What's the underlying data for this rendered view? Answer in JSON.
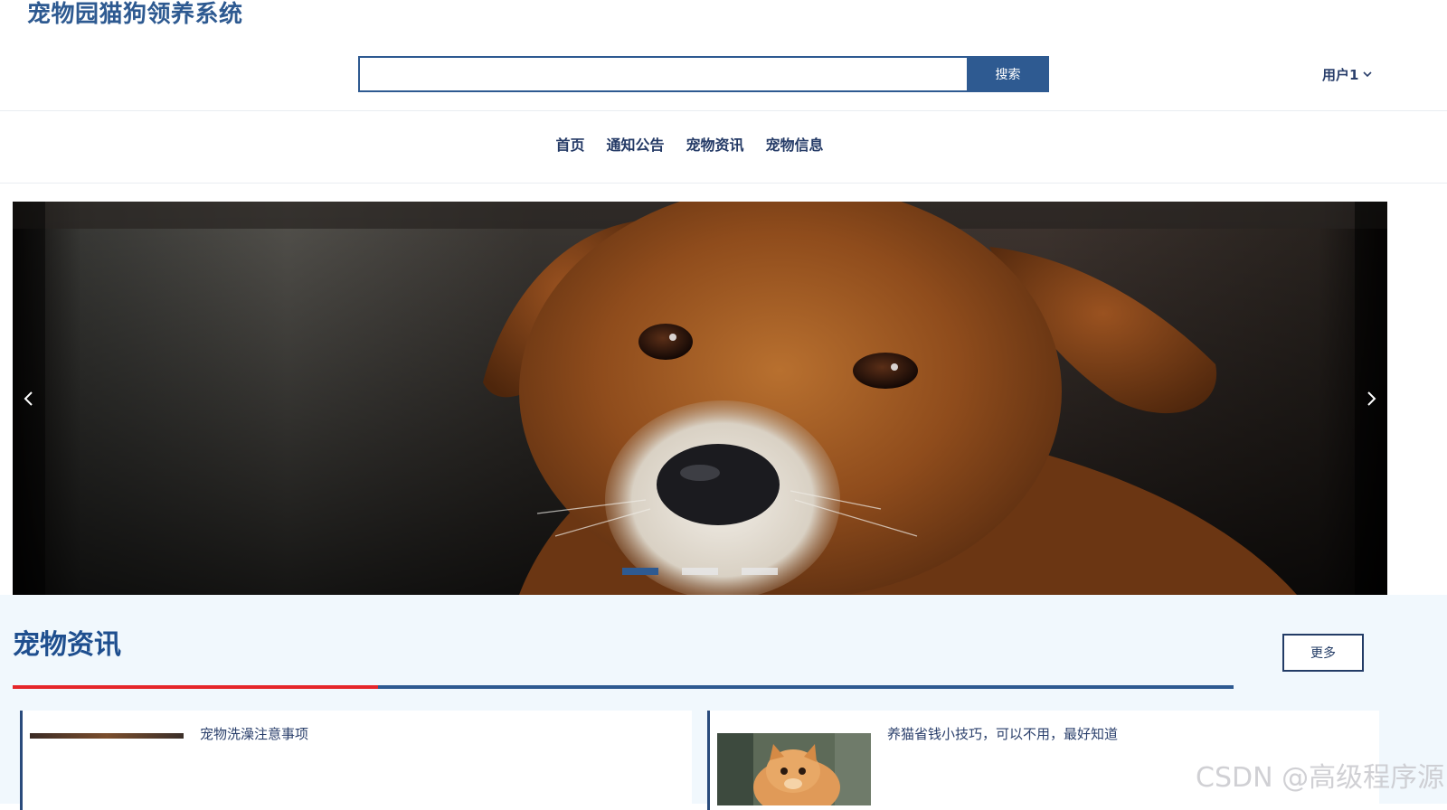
{
  "header": {
    "site_title": "宠物园猫狗领养系统",
    "search_placeholder": "",
    "search_button": "搜索",
    "user_label": "用户1"
  },
  "nav": {
    "items": [
      {
        "label": "首页"
      },
      {
        "label": "通知公告"
      },
      {
        "label": "宠物资讯"
      },
      {
        "label": "宠物信息"
      }
    ]
  },
  "banner": {
    "slide_count": 3,
    "active_slide": 1,
    "image_subject": "brown-puppy-photo"
  },
  "news": {
    "section_title": "宠物资讯",
    "more_label": "更多",
    "items": [
      {
        "title": "宠物洗澡注意事项",
        "thumb": "pet-bath-photo"
      },
      {
        "title": "养猫省钱小技巧，可以不用，最好知道",
        "thumb": "orange-kitten-photo"
      }
    ]
  },
  "watermark": "CSDN @高级程序源",
  "colors": {
    "brand_blue": "#2e5a91",
    "accent_red": "#e5262a",
    "section_bg": "#f1f8fd"
  }
}
